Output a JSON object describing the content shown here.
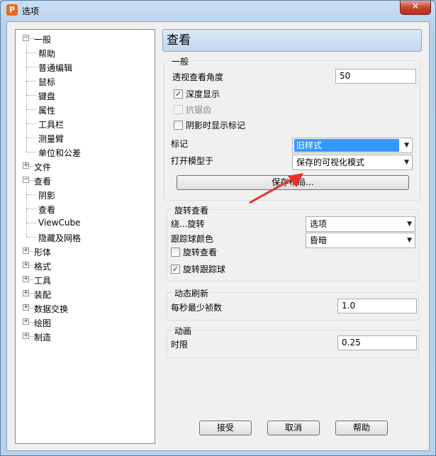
{
  "window": {
    "title": "选项",
    "app_icon_letter": "P",
    "close_glyph": "✕"
  },
  "tree": [
    {
      "label": "一般",
      "expanded": true,
      "children": [
        "帮助",
        "普通编辑",
        "鼠标",
        "键盘",
        "属性",
        "工具栏",
        "测量臂",
        "单位和公差"
      ]
    },
    {
      "label": "文件",
      "expanded": false
    },
    {
      "label": "查看",
      "expanded": true,
      "children": [
        "阴影",
        "查看",
        "ViewCube",
        "隐藏及网格"
      ]
    },
    {
      "label": "形体",
      "expanded": false
    },
    {
      "label": "格式",
      "expanded": false
    },
    {
      "label": "工具",
      "expanded": false
    },
    {
      "label": "装配",
      "expanded": false
    },
    {
      "label": "数据交换",
      "expanded": false
    },
    {
      "label": "绘图",
      "expanded": false
    },
    {
      "label": "制造",
      "expanded": false
    }
  ],
  "expand_glyphs": {
    "minus": "−",
    "plus": "+"
  },
  "panel": {
    "header": "查看",
    "general": {
      "title": "一般",
      "perspective_label": "透视查看角度",
      "perspective_value": "50",
      "depth_display": {
        "label": "深度显示",
        "checked": true
      },
      "antialias": {
        "label": "抗锯齿",
        "checked": false,
        "disabled": true
      },
      "shadow_markers": {
        "label": "阴影时显示标记",
        "checked": false
      },
      "marker_label": "标记",
      "marker_value": "旧样式",
      "open_model_label": "打开模型于",
      "open_model_value": "保存的可视化模式",
      "save_layout_button": "保存布局..."
    },
    "rotate": {
      "title": "旋转查看",
      "orbit_label": "绕...旋转",
      "orbit_value": "选项",
      "trackball_color_label": "跟踪球颜色",
      "trackball_color_value": "昏暗",
      "rotate_view": {
        "label": "旋转查看",
        "checked": false
      },
      "rotate_trackball": {
        "label": "旋转跟踪球",
        "checked": true
      }
    },
    "dynamic": {
      "title": "动态刷新",
      "min_fps_label": "每秒最少祯数",
      "min_fps_value": "1.0"
    },
    "animation": {
      "title": "动画",
      "duration_label": "时限",
      "duration_value": "0.25"
    }
  },
  "buttons": {
    "ok": "接受",
    "cancel": "取消",
    "help": "帮助"
  },
  "check_glyph": "✓",
  "dropdown_glyph": "▼",
  "colors": {
    "annotation_arrow": "#e8302a",
    "selection": "#3399ff"
  }
}
